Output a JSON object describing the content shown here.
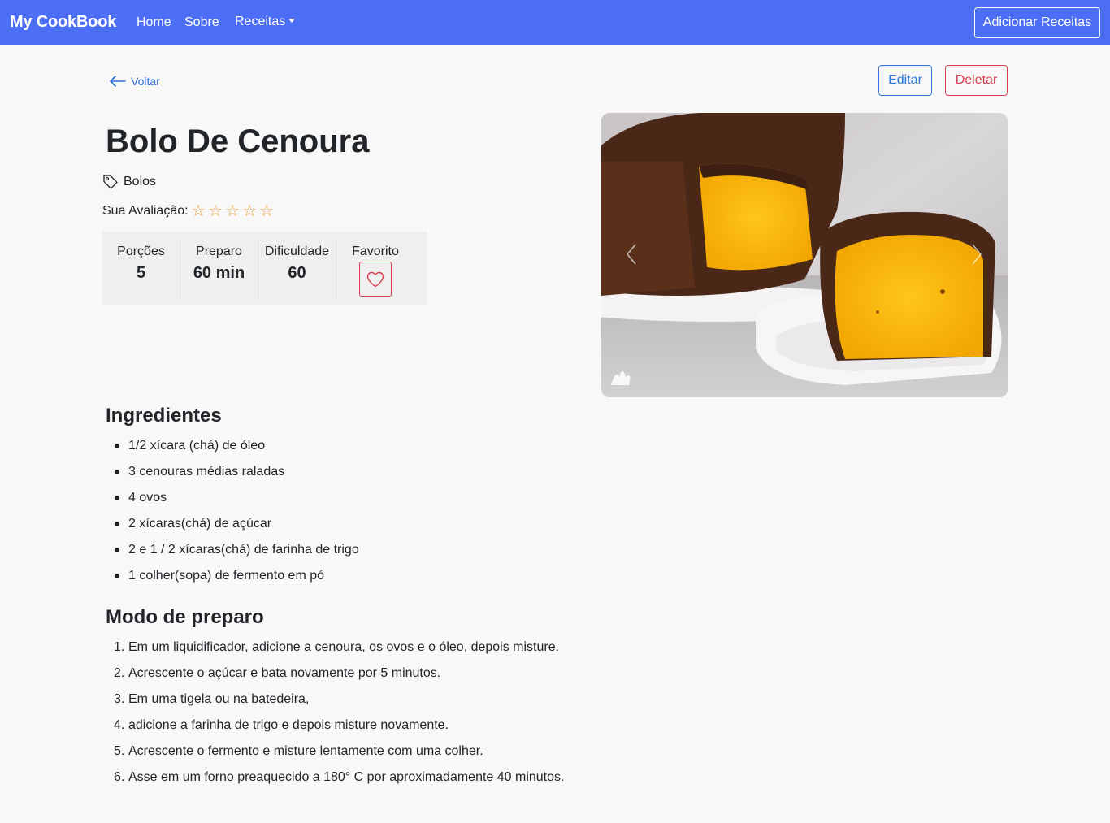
{
  "navbar": {
    "brand": "My CookBook",
    "links": [
      "Home",
      "Sobre"
    ],
    "dropdown_label": "Receitas",
    "add_button": "Adicionar Receitas"
  },
  "actions": {
    "back": "Voltar",
    "edit": "Editar",
    "delete": "Deletar"
  },
  "recipe": {
    "title": "Bolo De Cenoura",
    "category": "Bolos",
    "rating_label": "Sua Avaliação:",
    "rating_value": 0,
    "rating_max": 5,
    "stats": [
      {
        "label": "Porções",
        "value": "5"
      },
      {
        "label": "Preparo",
        "value": "60 min"
      },
      {
        "label": "Dificuldade",
        "value": "60"
      },
      {
        "label": "Favorito"
      }
    ]
  },
  "ingredients": {
    "heading": "Ingredientes",
    "items": [
      "1/2 xícara (chá) de óleo",
      "3 cenouras médias raladas",
      "4 ovos",
      "2 xícaras(chá) de açúcar",
      "2 e 1 / 2 xícaras(chá) de farinha de trigo",
      "1 colher(sopa) de fermento em pó"
    ]
  },
  "preparation": {
    "heading": "Modo de preparo",
    "steps": [
      "Em um liquidificador, adicione a cenoura, os ovos e o óleo, depois misture.",
      "Acrescente o açúcar e bata novamente por 5 minutos.",
      "Em uma tigela ou na batedeira,",
      "adicione a farinha de trigo e depois misture novamente.",
      "Acrescente o fermento e misture lentamente com uma colher.",
      "Asse em um forno preaquecido a 180° C por aproximadamente 40 minutos."
    ]
  },
  "icons": [
    "arrow-left-icon",
    "tag-icon",
    "star-icon",
    "heart-icon",
    "chevron-left-icon",
    "chevron-right-icon",
    "leaf-logo-icon"
  ],
  "colors": {
    "navbar": "#4c6ef5",
    "primary": "#2f78d6",
    "danger": "#d9404f",
    "star": "#e9a53a"
  }
}
